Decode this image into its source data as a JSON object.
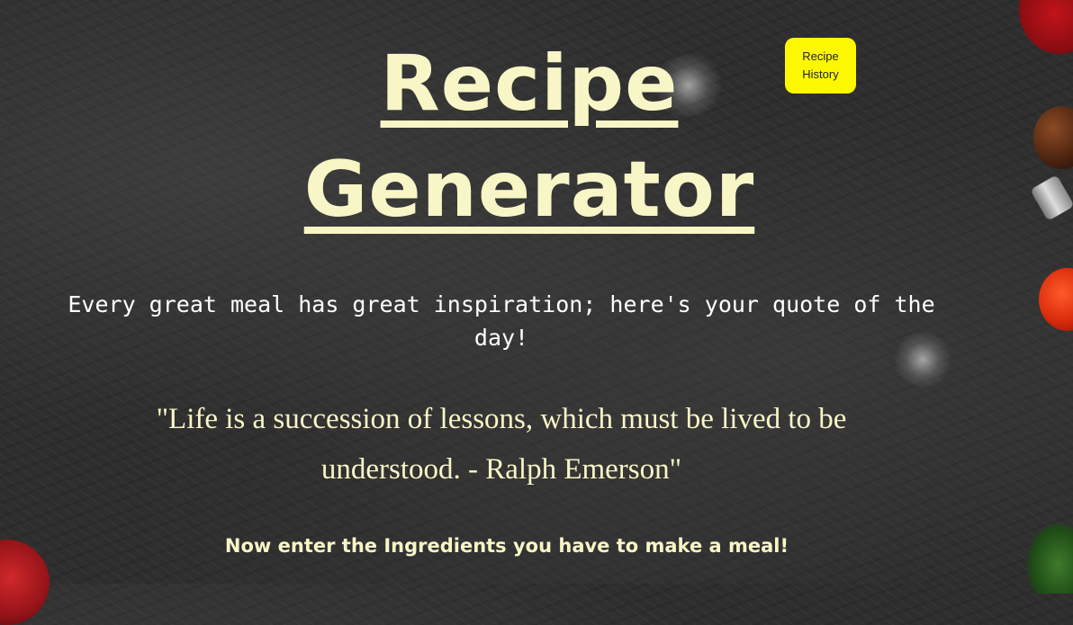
{
  "header": {
    "title_line_1": "Recipe",
    "title_line_2": "Generator",
    "history_button_label": "Recipe History"
  },
  "main": {
    "inspiration_text": "Every great meal has great inspiration; here's your quote of the day!",
    "quote_text": "\"Life is a succession of lessons, which must be lived to be understood. - Ralph Emerson\"",
    "ingredients_prompt": "Now enter the Ingredients you have to make a meal!"
  },
  "colors": {
    "title_text": "#f8f6c6",
    "history_button_bg": "#fdf700",
    "background": "#2e2e2e",
    "body_text": "#ffffff"
  }
}
